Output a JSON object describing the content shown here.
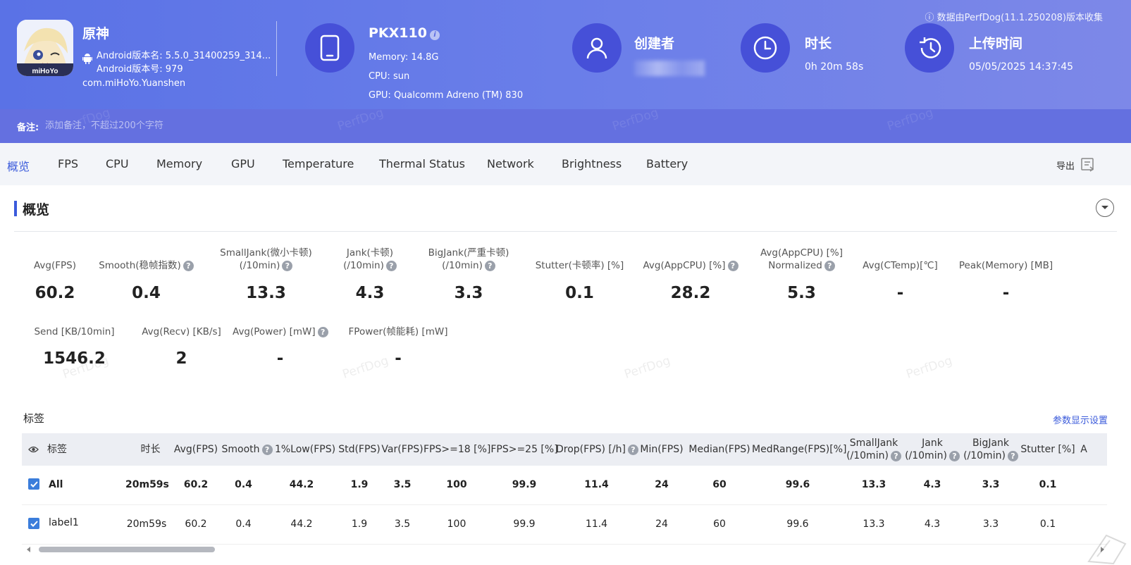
{
  "header": {
    "app": {
      "name": "原神",
      "android_version_name": "Android版本名: 5.5.0_31400259_314...",
      "android_version_code": "Android版本号: 979",
      "package": "com.miHoYo.Yuanshen",
      "icon_text": "miHoYo"
    },
    "device": {
      "model": "PKX110",
      "memory": "Memory: 14.8G",
      "cpu": "CPU: sun",
      "gpu": "GPU: Qualcomm Adreno (TM) 830"
    },
    "creator": {
      "title": "创建者"
    },
    "duration": {
      "title": "时长",
      "value": "0h 20m 58s"
    },
    "upload": {
      "title": "上传时间",
      "value": "05/05/2025 14:37:45"
    },
    "perfdog_note": "数据由PerfDog(11.1.250208)版本收集",
    "note_label": "备注:",
    "note_placeholder": "添加备注，不超过200个字符",
    "watermark": "PerfDog"
  },
  "tabs": [
    "概览",
    "FPS",
    "CPU",
    "Memory",
    "GPU",
    "Temperature",
    "Thermal Status",
    "Network",
    "Brightness",
    "Battery"
  ],
  "export_label": "导出",
  "overview": {
    "title": "概览",
    "metrics_row1": [
      {
        "label": "Avg(FPS)",
        "value": "60.2"
      },
      {
        "label": "Smooth(稳帧指数)",
        "value": "0.4"
      },
      {
        "label": "SmallJank(微小卡顿)",
        "label2": "(/10min)",
        "value": "13.3"
      },
      {
        "label": "Jank(卡顿)",
        "label2": "(/10min)",
        "value": "4.3"
      },
      {
        "label": "BigJank(严重卡顿)",
        "label2": "(/10min)",
        "value": "3.3"
      },
      {
        "label": "Stutter(卡顿率) [%]",
        "value": "0.1"
      },
      {
        "label": "Avg(AppCPU) [%]",
        "value": "28.2"
      },
      {
        "label": "Avg(AppCPU) [%]",
        "label2": "Normalized",
        "value": "5.3"
      },
      {
        "label": "Avg(CTemp)[℃]",
        "value": "-"
      },
      {
        "label": "Peak(Memory) [MB]",
        "value": "-"
      }
    ],
    "metrics_row2": [
      {
        "label": "Send [KB/10min]",
        "value": "1546.2"
      },
      {
        "label": "Avg(Recv) [KB/s]",
        "value": "2"
      },
      {
        "label": "Avg(Power) [mW]",
        "value": "-"
      },
      {
        "label": "FPower(帧能耗) [mW]",
        "value": "-"
      }
    ]
  },
  "labels_section": {
    "title": "标签",
    "param_link": "参数显示设置",
    "columns": [
      "标签",
      "时长",
      "Avg(FPS)",
      "Smooth",
      "1%Low(FPS)",
      "Std(FPS)",
      "Var(FPS)",
      "FPS>=18 [%]",
      "FPS>=25 [%]",
      "Drop(FPS) [/h]",
      "Min(FPS)",
      "Median(FPS)",
      "MedRange(FPS)[%]",
      "SmallJank",
      "Jank",
      "BigJank",
      "Stutter [%]",
      "A"
    ],
    "col_sub": "(/10min)",
    "rows": [
      {
        "label": "All",
        "cells": [
          "20m59s",
          "60.2",
          "0.4",
          "44.2",
          "1.9",
          "3.5",
          "100",
          "99.9",
          "11.4",
          "24",
          "60",
          "99.6",
          "13.3",
          "4.3",
          "3.3",
          "0.1"
        ]
      },
      {
        "label": "label1",
        "cells": [
          "20m59s",
          "60.2",
          "0.4",
          "44.2",
          "1.9",
          "3.5",
          "100",
          "99.9",
          "11.4",
          "24",
          "60",
          "99.6",
          "13.3",
          "4.3",
          "3.3",
          "0.1"
        ]
      }
    ]
  },
  "colors": {
    "accent": "#3b5bdb",
    "header_start": "#5a72e6",
    "header_end": "#7d88e8",
    "circle": "#4650d8",
    "checkbox": "#3b7ddb"
  }
}
